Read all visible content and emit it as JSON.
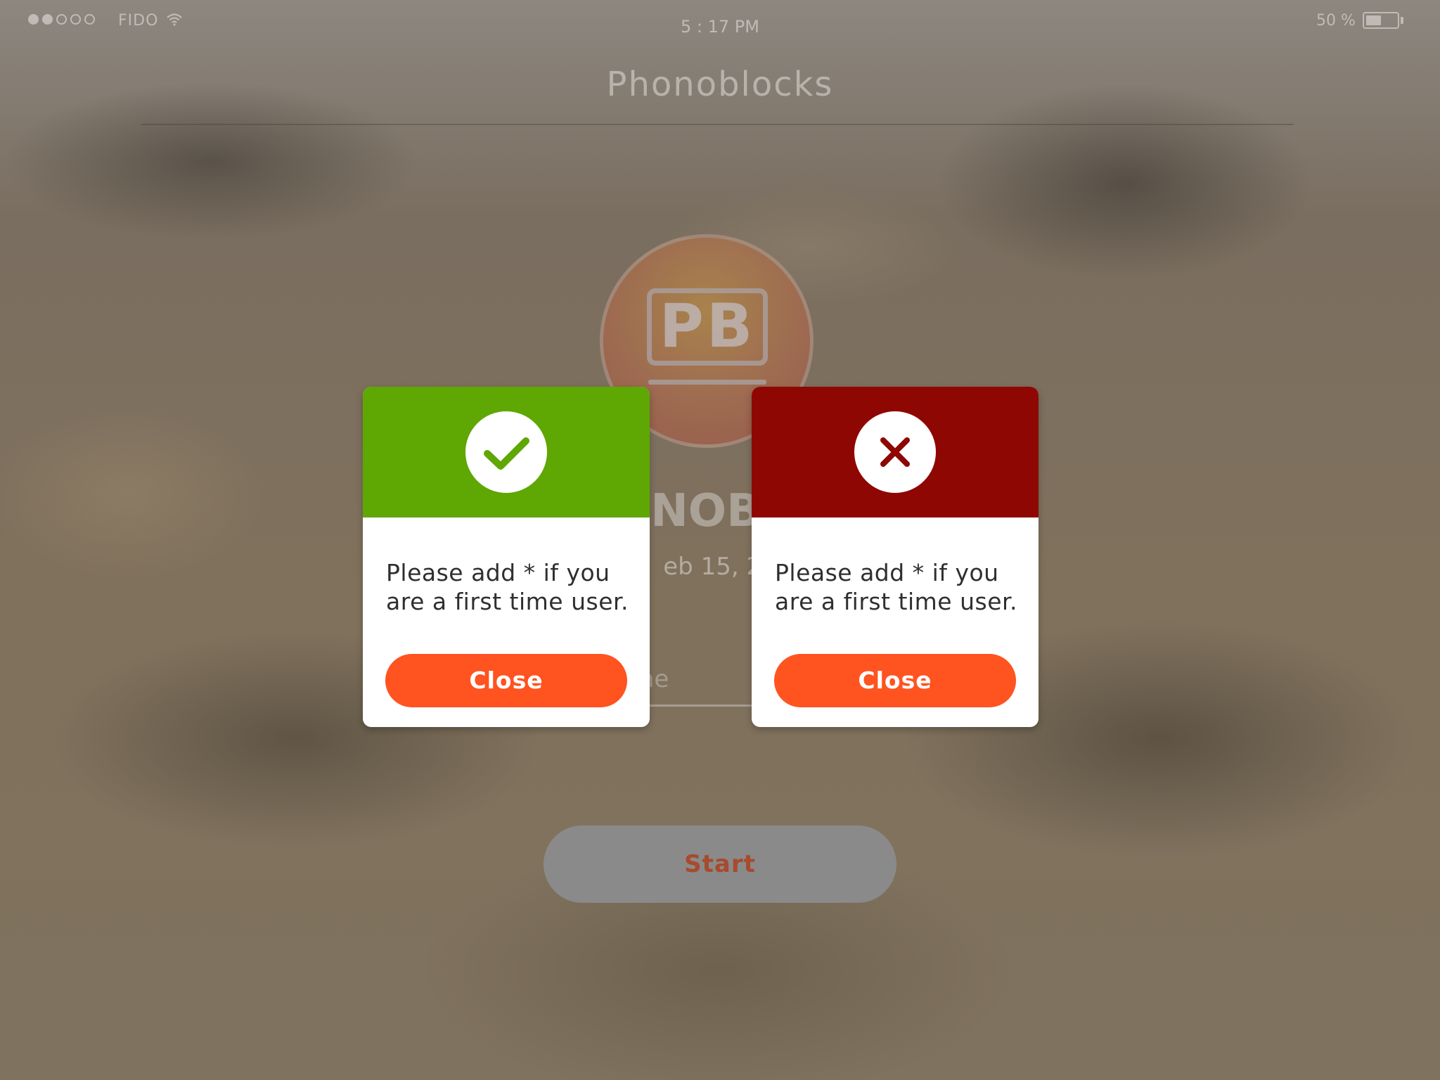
{
  "status_bar": {
    "carrier": "FIDO",
    "time": "5 : 17 PM",
    "battery_percent": "50 %",
    "battery_level": 0.5,
    "signal_bars_filled": 2,
    "signal_bars_total": 5
  },
  "app": {
    "title": "Phonoblocks",
    "logo_text": "PB"
  },
  "background": {
    "name_partial": "NOBL",
    "date_partial": "eb 15, 20",
    "input_placeholder_partial": "ne",
    "start_label": "Start"
  },
  "dialogs": [
    {
      "type": "success",
      "icon": "checkmark-icon",
      "header_color": "#5fa703",
      "message": "Please add * if you are a first time user.",
      "button_label": "Close"
    },
    {
      "type": "error",
      "icon": "close-x-icon",
      "header_color": "#8f0703",
      "message": "Please add * if you are a first time user.",
      "button_label": "Close"
    }
  ],
  "colors": {
    "accent": "#ff5320",
    "success": "#5fa703",
    "error": "#8f0703"
  }
}
